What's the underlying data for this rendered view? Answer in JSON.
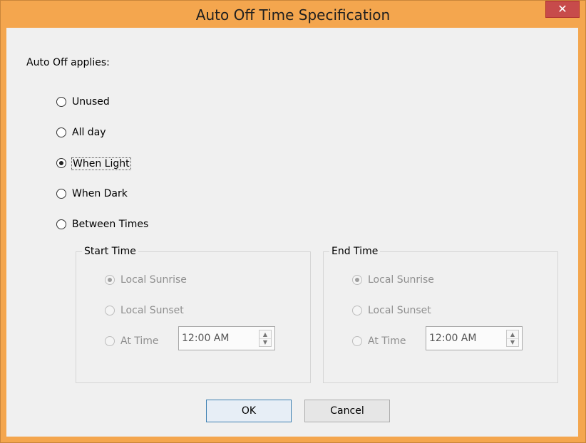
{
  "window": {
    "title": "Auto Off Time Specification",
    "close_glyph": "✕"
  },
  "prompt_label": "Auto Off applies:",
  "options": [
    {
      "label": "Unused",
      "checked": false
    },
    {
      "label": "All day",
      "checked": false
    },
    {
      "label": "When Light",
      "checked": true
    },
    {
      "label": "When Dark",
      "checked": false
    },
    {
      "label": "Between Times",
      "checked": false
    }
  ],
  "start_time": {
    "title": "Start Time",
    "options": [
      {
        "label": "Local Sunrise",
        "checked": true
      },
      {
        "label": "Local Sunset",
        "checked": false
      },
      {
        "label": "At Time",
        "checked": false
      }
    ],
    "time_value": "12:00 AM"
  },
  "end_time": {
    "title": "End Time",
    "options": [
      {
        "label": "Local Sunrise",
        "checked": true
      },
      {
        "label": "Local Sunset",
        "checked": false
      },
      {
        "label": "At Time",
        "checked": false
      }
    ],
    "time_value": "12:00 AM"
  },
  "buttons": {
    "ok": "OK",
    "cancel": "Cancel"
  },
  "colors": {
    "title_bar": "#f4a64e",
    "close_button": "#c74b4b",
    "client_bg": "#f0f0f0",
    "disabled_text": "#8f8f8f"
  }
}
